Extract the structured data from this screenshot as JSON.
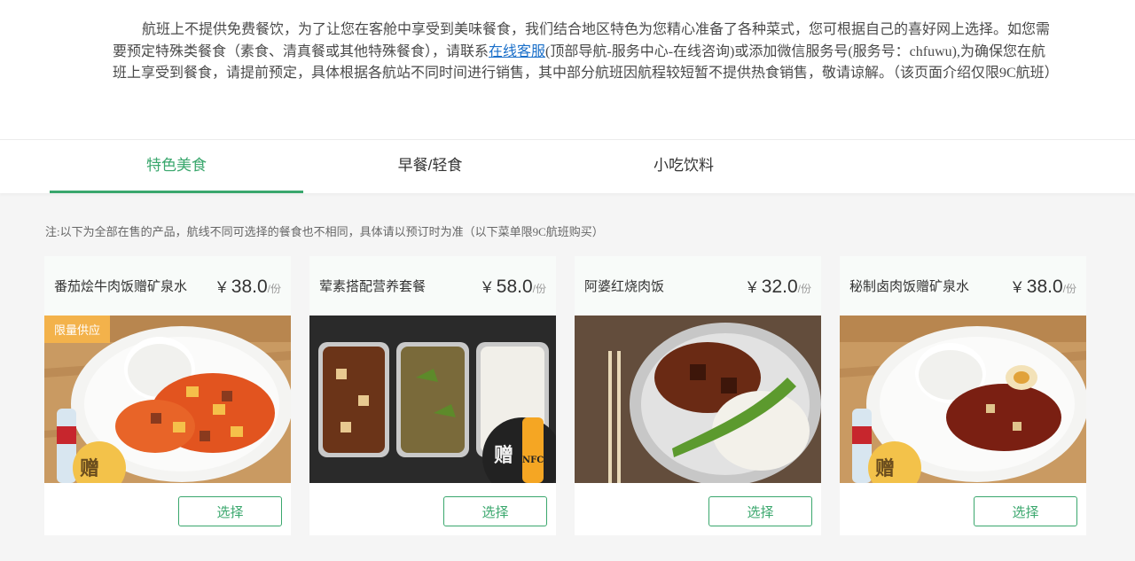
{
  "intro": {
    "before_link": "航班上不提供免费餐饮，为了让您在客舱中享受到美味餐食，我们结合地区特色为您精心准备了各种菜式，您可根据自己的喜好网上选择。如您需要预定特殊类餐食（素食、清真餐或其他特殊餐食），请联系",
    "link": "在线客服",
    "after_link": "(顶部导航-服务中心-在线咨询)或添加微信服务号(服务号：chfuwu),为确保您在航班上享受到餐食，请提前预定，具体根据各航站不同时间进行销售，其中部分航班因航程较短暂不提供热食销售，敬请谅解。（该页面介绍仅限9C航班）"
  },
  "tabs": [
    {
      "label": "特色美食",
      "active": true
    },
    {
      "label": "早餐/轻食",
      "active": false
    },
    {
      "label": "小吃饮料",
      "active": false
    }
  ],
  "note": "注:以下为全部在售的产品，航线不同可选择的餐食也不相同，具体请以预订时为准（以下菜单限9C航班购买）",
  "products": [
    {
      "name": "番茄烩牛肉饭赠矿泉水",
      "currency": "￥",
      "price": "38.0",
      "unit": "/份",
      "tag": "限量供应",
      "gift": "赠",
      "image_icon": "tomato-beef-rice-image",
      "button": "选择"
    },
    {
      "name": "荤素搭配营养套餐",
      "currency": "￥",
      "price": "58.0",
      "unit": "/份",
      "tag": "",
      "gift": "赠",
      "gift_extra": "NFC",
      "image_icon": "combo-meal-image",
      "button": "选择"
    },
    {
      "name": "阿婆红烧肉饭",
      "currency": "￥",
      "price": "32.0",
      "unit": "/份",
      "tag": "",
      "gift": "",
      "image_icon": "braised-pork-rice-image",
      "button": "选择"
    },
    {
      "name": "秘制卤肉饭赠矿泉水",
      "currency": "￥",
      "price": "38.0",
      "unit": "/份",
      "tag": "",
      "gift": "赠",
      "image_icon": "braised-meat-rice-image",
      "button": "选择"
    }
  ],
  "colors": {
    "accent": "#3aa76d",
    "link": "#1a6fc9",
    "tag": "#f3b24b"
  }
}
